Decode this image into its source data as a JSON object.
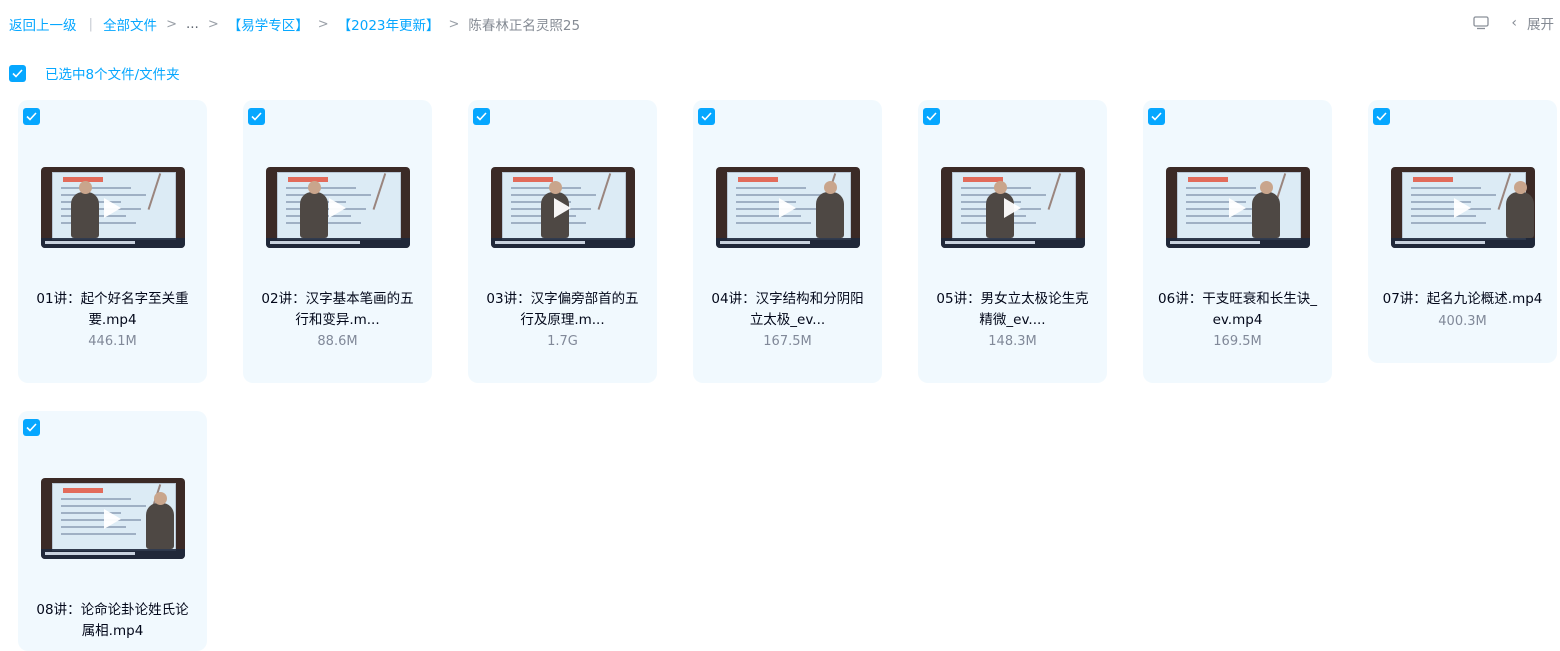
{
  "breadcrumb": {
    "back": "返回上一级",
    "root": "全部文件",
    "ellipsis": "...",
    "folder1": "【易学专区】",
    "folder2": "【2023年更新】",
    "current": "陈春林正名灵照25"
  },
  "header": {
    "collapse_label": "展开"
  },
  "selection": {
    "text": "已选中8个文件/文件夹"
  },
  "files": [
    {
      "name": "01讲：起个好名字至关重要.mp4",
      "size": "446.1M"
    },
    {
      "name": "02讲：汉字基本笔画的五行和变异.m...",
      "size": "88.6M"
    },
    {
      "name": "03讲：汉字偏旁部首的五行及原理.m...",
      "size": "1.7G"
    },
    {
      "name": "04讲：汉字结构和分阴阳立太极_ev...",
      "size": "167.5M"
    },
    {
      "name": "05讲：男女立太极论生克精微_ev....",
      "size": "148.3M"
    },
    {
      "name": "06讲：干支旺衰和长生诀_ev.mp4",
      "size": "169.5M"
    },
    {
      "name": "07讲：起名九论概述.mp4",
      "size": "400.3M"
    },
    {
      "name": "08讲：论命论卦论姓氏论属相.mp4",
      "size": ""
    }
  ],
  "colors": {
    "accent": "#06a7ff",
    "card_bg": "#f1f9fe"
  },
  "icons": {
    "checkbox": "checkbox-checked-icon",
    "play": "play-icon",
    "monitor": "monitor-icon",
    "chevron": "chevron-left-icon"
  }
}
